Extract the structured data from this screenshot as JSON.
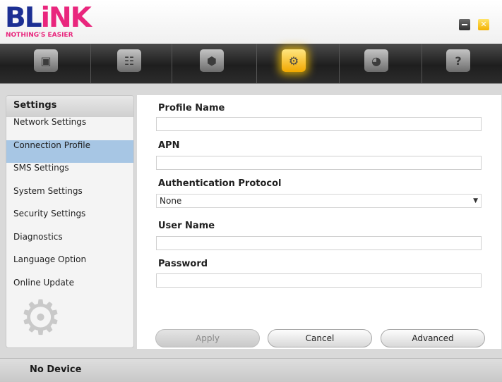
{
  "header": {
    "logo": {
      "text_main": "BL",
      "text_accent": "iNK",
      "tagline": "NOTHING'S EASIER"
    },
    "window_controls": {
      "minimize_icon": "minimize-icon",
      "close_icon": "close-icon",
      "close_glyph": "✕"
    }
  },
  "toolbar": {
    "items": [
      {
        "name": "connection",
        "icon": "monitor-icon",
        "glyph": "▣"
      },
      {
        "name": "contacts",
        "icon": "contacts-icon",
        "glyph": "☷"
      },
      {
        "name": "sms",
        "icon": "box-icon",
        "glyph": "⬢"
      },
      {
        "name": "settings",
        "icon": "gear-icon",
        "glyph": "⚙",
        "active": true
      },
      {
        "name": "internet",
        "icon": "globe-icon",
        "glyph": "◕"
      },
      {
        "name": "help",
        "icon": "help-icon",
        "glyph": "?"
      }
    ]
  },
  "sidebar": {
    "title": "Settings",
    "items": [
      {
        "label": "Network Settings"
      },
      {
        "label": "Connection Profile",
        "selected": true
      },
      {
        "label": "SMS Settings"
      },
      {
        "label": "System Settings"
      },
      {
        "label": "Security Settings"
      },
      {
        "label": "Diagnostics"
      },
      {
        "label": "Language Option"
      },
      {
        "label": "Online Update"
      }
    ],
    "decoration_icon": "gear-icon"
  },
  "form": {
    "profile_name": {
      "label": "Profile Name",
      "value": ""
    },
    "apn": {
      "label": "APN",
      "value": ""
    },
    "auth_protocol": {
      "label": "Authentication Protocol",
      "value": "None",
      "arrow": "▼"
    },
    "user_name": {
      "label": "User Name",
      "value": ""
    },
    "password": {
      "label": "Password",
      "value": ""
    }
  },
  "buttons": {
    "apply": "Apply",
    "cancel": "Cancel",
    "advanced": "Advanced"
  },
  "status": {
    "text": "No Device"
  },
  "colors": {
    "brand_blue": "#1c2f93",
    "brand_pink": "#e9267d",
    "selection": "#a7c6e4",
    "active_tool": "#f1a800"
  }
}
